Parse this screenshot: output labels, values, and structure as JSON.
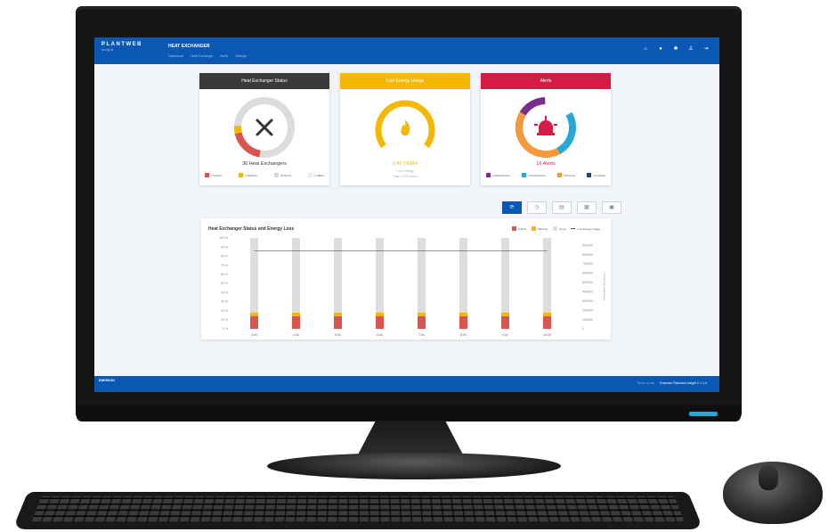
{
  "app": {
    "brand": "PLANTWEB",
    "brand_sub": "insight",
    "title": "HEAT EXCHANGER",
    "nav": [
      "Dashboard",
      "Heat Exchanger",
      "Alerts",
      "Settings"
    ],
    "top_icons": [
      "home-icon",
      "info-icon",
      "settings-icon",
      "user-icon",
      "logout-icon"
    ]
  },
  "cards": {
    "status": {
      "header": "Heat Exchanger Status",
      "header_color": "#3a3a3a",
      "icon": "tools-icon",
      "value": "36 Heat Exchangers",
      "legend": [
        "7 Critical",
        "3 Warning",
        "25 Good",
        "1 Offline"
      ],
      "legend_colors": [
        "#d9534f",
        "#f5b800",
        "#d8d8d8",
        "#ececec"
      ]
    },
    "energy": {
      "header": "Lost Energy Usage",
      "header_color": "#f5b800",
      "icon": "flame-icon",
      "value": "0.45 TKWH",
      "sub1": "Loss Energy",
      "sub2": "Total 1.2000 kw/m"
    },
    "alerts": {
      "header": "Alerts",
      "header_color": "#d81b45",
      "icon": "siren-icon",
      "value": "16 Alerts",
      "legend": [
        "4 Maintenance",
        "3 Performance",
        "5 Process",
        "4 Analysis"
      ],
      "legend_colors": [
        "#7b2d8e",
        "#29a8d8",
        "#f59a3b",
        "#1c3f94"
      ]
    }
  },
  "toolbar": {
    "buttons": [
      "refresh-icon",
      "clock-icon",
      "calendar-day-icon",
      "calendar-week-icon",
      "calendar-month-icon"
    ]
  },
  "chart_data": {
    "type": "bar",
    "title": "Heat Exchanger Status and Energy Loss",
    "categories": [
      "3:00",
      "4:00",
      "5:00",
      "6:00",
      "7:00",
      "8:00",
      "9:00",
      "10:00"
    ],
    "y_ticks": [
      "0 %",
      "10 %",
      "20 %",
      "30 %",
      "40 %",
      "50 %",
      "60 %",
      "70 %",
      "80 %",
      "90 %",
      "100 %"
    ],
    "y2_ticks": [
      "0",
      "100000",
      "200000",
      "300000",
      "400000",
      "500000",
      "600000",
      "700000",
      "800000",
      "900000"
    ],
    "y2_label": "Lost Energy Usage (kw)",
    "series": [
      {
        "name": "Critical",
        "color": "#d9534f",
        "values": [
          14,
          14,
          14,
          14,
          14,
          14,
          14,
          14
        ]
      },
      {
        "name": "Warning",
        "color": "#f5b800",
        "values": [
          4,
          4,
          4,
          4,
          4,
          4,
          4,
          4
        ]
      },
      {
        "name": "Good",
        "color": "#dddddd",
        "values": [
          82,
          82,
          82,
          82,
          82,
          82,
          82,
          82
        ]
      }
    ],
    "line": {
      "name": "Lost Energy Usage",
      "color": "#555555",
      "value": 770000
    },
    "legend": [
      "Critical",
      "Warning",
      "Good",
      "Lost Energy Usage"
    ],
    "ylim": [
      0,
      100
    ],
    "y2lim": [
      0,
      900000
    ]
  },
  "footer": {
    "logo": "EMERSON",
    "link1": "Terms of use",
    "link2": "Emerson Plantweb Insight V 1.1.4"
  }
}
